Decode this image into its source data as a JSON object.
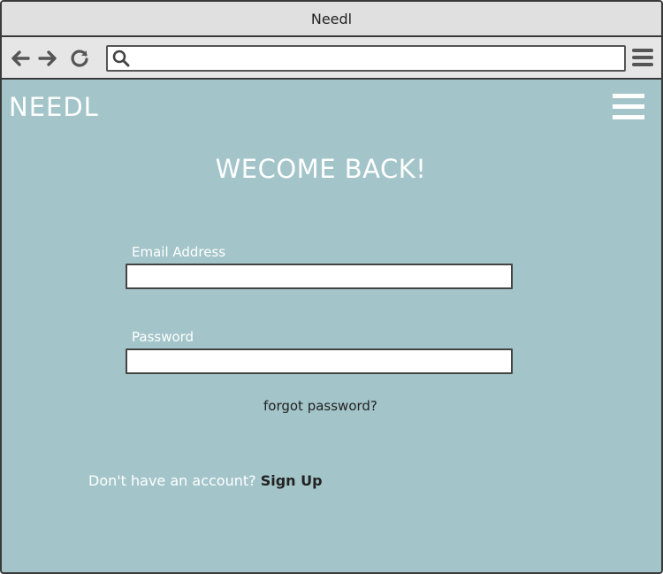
{
  "window": {
    "title": "Needl"
  },
  "browser": {
    "url_value": "",
    "icons": {
      "back": "arrow-left-icon",
      "forward": "arrow-right-icon",
      "reload": "reload-icon",
      "search": "search-icon",
      "menu": "menu-icon"
    }
  },
  "header": {
    "brand": "NEEDL",
    "menu_icon": "hamburger-icon"
  },
  "login": {
    "heading": "WECOME BACK!",
    "email_label": "Email Address",
    "email_value": "",
    "password_label": "Password",
    "password_value": "",
    "forgot_link": "forgot password?",
    "signup_prompt": "Don't have an account?",
    "signup_link": "Sign Up"
  },
  "colors": {
    "page_background": "#a3c5ca",
    "chrome_background": "#e0e0e0",
    "text_light": "#ffffff",
    "text_dark": "#222222"
  }
}
